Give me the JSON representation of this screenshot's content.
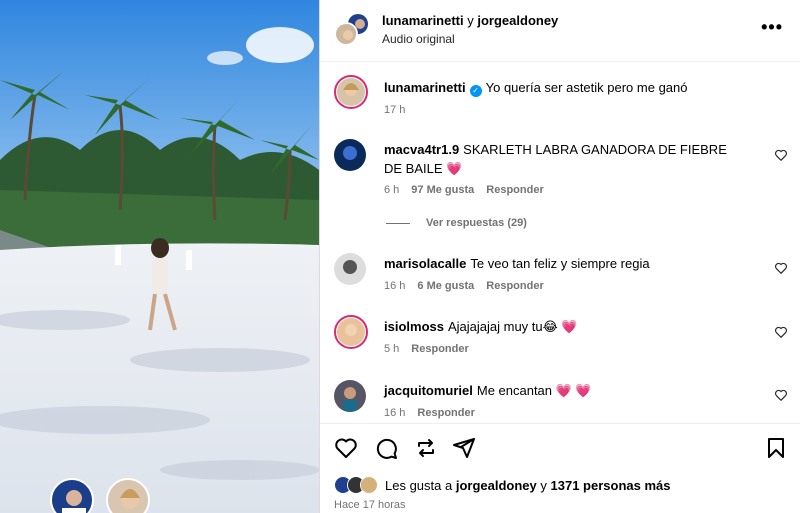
{
  "header": {
    "user1": "lunamarinetti",
    "joiner": "y",
    "user2": "jorgealdoney",
    "subtitle": "Audio original",
    "more_icon": "more-options-icon"
  },
  "caption": {
    "username": "lunamarinetti",
    "verified": true,
    "text": "Yo quería ser astetik pero me ganó",
    "time": "17 h"
  },
  "comments": [
    {
      "username": "macva4tr1.9",
      "text": "SKARLETH LABRA GANADORA DE FIEBRE DE BAILE 💗",
      "time": "6 h",
      "likes": "97 Me gusta",
      "reply": "Responder"
    },
    {
      "username": "marisolacalle",
      "text": "Te veo tan feliz y siempre regia",
      "time": "16 h",
      "likes": "6 Me gusta",
      "reply": "Responder"
    },
    {
      "username": "isiolmoss",
      "text": "Ajajajajaj muy tu😂 💗",
      "time": "5 h",
      "likes": "",
      "reply": "Responder"
    },
    {
      "username": "jacquitomuriel",
      "text": "Me encantan 💗 💗",
      "time": "16 h",
      "likes": "",
      "reply": "Responder"
    }
  ],
  "view_replies": "Ver respuestas (29)",
  "likes_summary": {
    "prefix": "Les gusta a",
    "user": "jorgealdoney",
    "joiner": "y",
    "others": "1371 personas más"
  },
  "time_ago": "Hace 17 horas",
  "icons": [
    "heart-icon",
    "comment-icon",
    "repost-icon",
    "share-icon",
    "save-icon"
  ],
  "colors": {
    "verified": "#0095f6",
    "story_ring": "#d62976",
    "meta_gray": "#737373"
  }
}
